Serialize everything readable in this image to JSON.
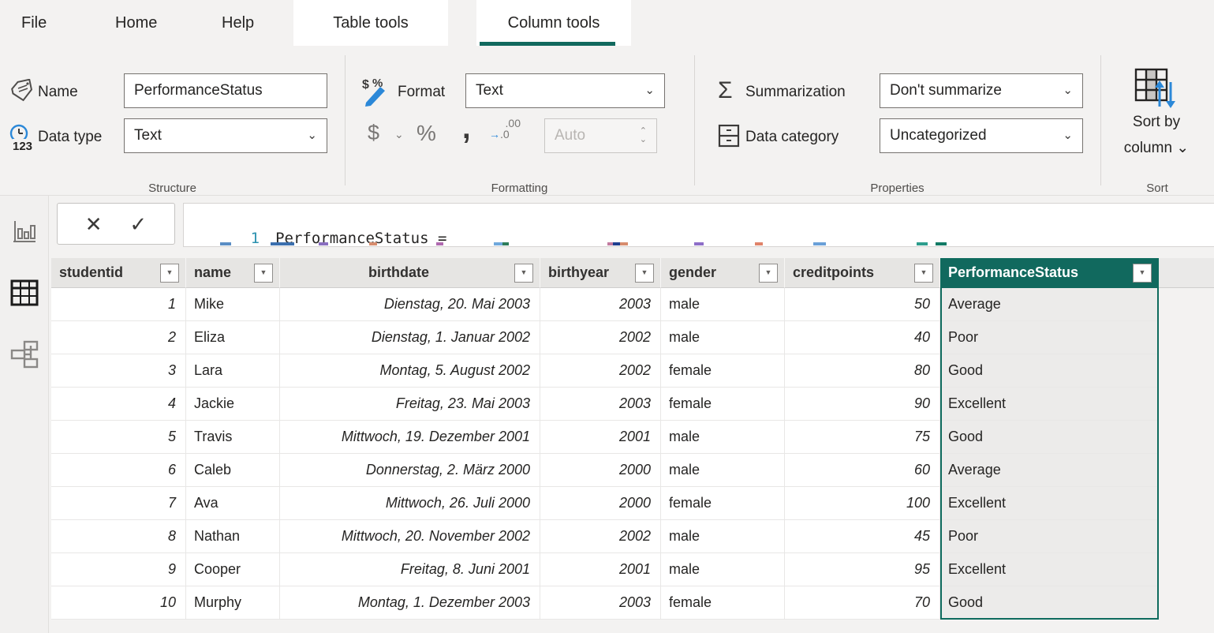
{
  "menu": {
    "items": [
      {
        "label": "File"
      },
      {
        "label": "Home"
      },
      {
        "label": "Help"
      }
    ],
    "contextual_tabs": [
      {
        "label": "Table tools",
        "active": false
      },
      {
        "label": "Column tools",
        "active": true
      }
    ]
  },
  "ribbon": {
    "structure": {
      "group_label": "Structure",
      "name_label": "Name",
      "name_value": "PerformanceStatus",
      "datatype_label": "Data type",
      "datatype_value": "Text"
    },
    "formatting": {
      "group_label": "Formatting",
      "format_label": "Format",
      "format_value": "Text",
      "decimal_places_value": "Auto"
    },
    "properties": {
      "group_label": "Properties",
      "summarization_label": "Summarization",
      "summarization_value": "Don't summarize",
      "datacategory_label": "Data category",
      "datacategory_value": "Uncategorized"
    },
    "sort": {
      "group_label": "Sort",
      "button_line1": "Sort by",
      "button_line2": "column ⌄"
    }
  },
  "icons": {
    "close": "✕",
    "check": "✓",
    "chevron_down": "⌄",
    "spinner_up": "⌃",
    "spinner_down": "⌄",
    "filter_arrow": "▼",
    "sigma": "Σ",
    "dollar": "$",
    "dollar_chevron": "⌄",
    "percent": "%",
    "comma": ",",
    "decimal_top": ".00",
    "decimal_bottom_arrow": "→",
    "decimal_bottom_digits": ".0"
  },
  "formula_bar": {
    "line_number": "1",
    "code": "PerformanceStatus ="
  },
  "table": {
    "columns": [
      {
        "key": "studentid",
        "label": "studentid",
        "align": "left",
        "cell": "num",
        "selected": false
      },
      {
        "key": "name",
        "label": "name",
        "align": "left",
        "cell": "text",
        "selected": false
      },
      {
        "key": "birthdate",
        "label": "birthdate",
        "align": "center",
        "cell": "num",
        "selected": false
      },
      {
        "key": "birthyear",
        "label": "birthyear",
        "align": "left",
        "cell": "num",
        "selected": false
      },
      {
        "key": "gender",
        "label": "gender",
        "align": "left",
        "cell": "text",
        "selected": false
      },
      {
        "key": "creditpoints",
        "label": "creditpoints",
        "align": "left",
        "cell": "num",
        "selected": false
      },
      {
        "key": "status",
        "label": "PerformanceStatus",
        "align": "left",
        "cell": "status",
        "selected": true
      }
    ],
    "rows": [
      {
        "studentid": "1",
        "name": "Mike",
        "birthdate": "Dienstag, 20. Mai 2003",
        "birthyear": "2003",
        "gender": "male",
        "creditpoints": "50",
        "status": "Average"
      },
      {
        "studentid": "2",
        "name": "Eliza",
        "birthdate": "Dienstag, 1. Januar 2002",
        "birthyear": "2002",
        "gender": "male",
        "creditpoints": "40",
        "status": "Poor"
      },
      {
        "studentid": "3",
        "name": "Lara",
        "birthdate": "Montag, 5. August 2002",
        "birthyear": "2002",
        "gender": "female",
        "creditpoints": "80",
        "status": "Good"
      },
      {
        "studentid": "4",
        "name": "Jackie",
        "birthdate": "Freitag, 23. Mai 2003",
        "birthyear": "2003",
        "gender": "female",
        "creditpoints": "90",
        "status": "Excellent"
      },
      {
        "studentid": "5",
        "name": "Travis",
        "birthdate": "Mittwoch, 19. Dezember 2001",
        "birthyear": "2001",
        "gender": "male",
        "creditpoints": "75",
        "status": "Good"
      },
      {
        "studentid": "6",
        "name": "Caleb",
        "birthdate": "Donnerstag, 2. März 2000",
        "birthyear": "2000",
        "gender": "male",
        "creditpoints": "60",
        "status": "Average"
      },
      {
        "studentid": "7",
        "name": "Ava",
        "birthdate": "Mittwoch, 26. Juli 2000",
        "birthyear": "2000",
        "gender": "female",
        "creditpoints": "100",
        "status": "Excellent"
      },
      {
        "studentid": "8",
        "name": "Nathan",
        "birthdate": "Mittwoch, 20. November 2002",
        "birthyear": "2002",
        "gender": "male",
        "creditpoints": "45",
        "status": "Poor"
      },
      {
        "studentid": "9",
        "name": "Cooper",
        "birthdate": "Freitag, 8. Juni 2001",
        "birthyear": "2001",
        "gender": "male",
        "creditpoints": "95",
        "status": "Excellent"
      },
      {
        "studentid": "10",
        "name": "Murphy",
        "birthdate": "Montag, 1. Dezember 2003",
        "birthyear": "2003",
        "gender": "female",
        "creditpoints": "70",
        "status": "Good"
      }
    ]
  },
  "sidebar": {
    "views": [
      {
        "name": "report-view",
        "active": false
      },
      {
        "name": "data-view",
        "active": true
      },
      {
        "name": "model-view",
        "active": false
      }
    ]
  },
  "colors": {
    "accent_teal": "#11695E",
    "ribbon_bg": "#f3f2f1",
    "header_bg": "#e6e5e3",
    "selected_cell_bg": "#ECEBEA",
    "line_number_blue": "#2B91AF"
  }
}
